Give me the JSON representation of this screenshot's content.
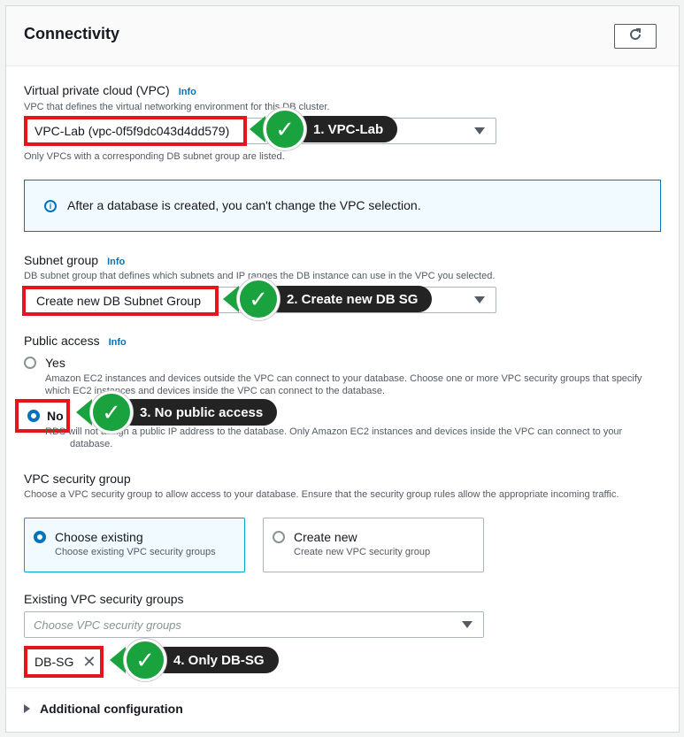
{
  "panel": {
    "title": "Connectivity"
  },
  "vpc": {
    "label": "Virtual private cloud (VPC)",
    "info": "Info",
    "description": "VPC that defines the virtual networking environment for this DB cluster.",
    "value": "VPC-Lab (vpc-0f5f9dc043d4dd579)",
    "hint": "Only VPCs with a corresponding DB subnet group are listed."
  },
  "alert": {
    "text": "After a database is created, you can't change the VPC selection."
  },
  "subnet": {
    "label": "Subnet group",
    "info": "Info",
    "description": "DB subnet group that defines which subnets and IP ranges the DB instance can use in the VPC you selected.",
    "value": "Create new DB Subnet Group"
  },
  "public_access": {
    "label": "Public access",
    "info": "Info",
    "yes_label": "Yes",
    "yes_description": "Amazon EC2 instances and devices outside the VPC can connect to your database. Choose one or more VPC security groups that specify which EC2 instances and devices inside the VPC can connect to the database.",
    "no_label": "No",
    "no_description": "RDS will not assign a public IP address to the database. Only Amazon EC2 instances and devices inside the VPC can connect to your database.",
    "selected": "No"
  },
  "security_group": {
    "label": "VPC security group",
    "description": "Choose a VPC security group to allow access to your database. Ensure that the security group rules allow the appropriate incoming traffic.",
    "option_existing_title": "Choose existing",
    "option_existing_sub": "Choose existing VPC security groups",
    "option_new_title": "Create new",
    "option_new_sub": "Create new VPC security group",
    "selected": "Choose existing"
  },
  "existing_groups": {
    "label": "Existing VPC security groups",
    "placeholder": "Choose VPC security groups",
    "token": "DB-SG"
  },
  "additional": {
    "label": "Additional configuration"
  },
  "annotations": [
    {
      "label": "1. VPC-Lab"
    },
    {
      "label": "2. Create new DB SG"
    },
    {
      "label": "3. No public access"
    },
    {
      "label": "4. Only DB-SG"
    }
  ],
  "colors": {
    "accent": "#0073bb",
    "highlight": "#e8141c",
    "check": "#1aa23e",
    "callout": "#232323"
  }
}
